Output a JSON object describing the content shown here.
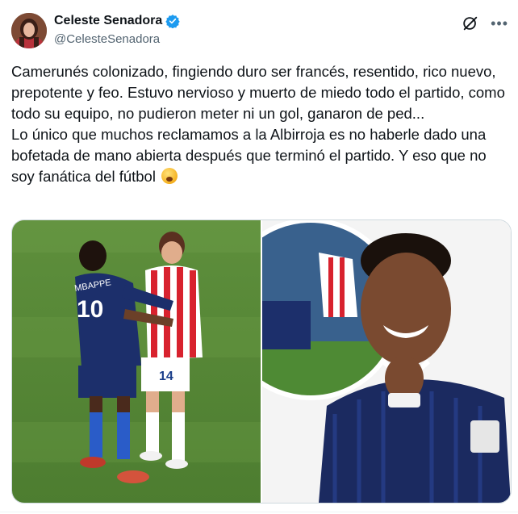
{
  "author": {
    "display_name": "Celeste Senadora",
    "handle": "@CelesteSenadora",
    "verified_badge": "verified-badge-icon",
    "avatar": "avatar"
  },
  "tweet": {
    "text_1": "Camerunés colonizado, fingiendo duro ser francés, resentido, rico nuevo, prepotente y feo. Estuvo nervioso y muerto de miedo todo el partido, como todo su equipo, no pudieron meter ni un gol, ganaron de ped...",
    "text_2": "Lo único que muchos reclamamos a la Albirroja es no haberle dado una bofetada de mano abierta después que terminó el partido. Y eso que no soy fanática del fútbol"
  },
  "media": {
    "image_left": "photo-players-confrontation",
    "image_right": "photo-player-smiling-collage",
    "left_jersey_back": "10",
    "left_jersey_name": "MBAPPE",
    "right_jersey_number": "14"
  },
  "colors": {
    "accent": "#1d9bf0",
    "text": "#0f1419",
    "secondary": "#536471",
    "border": "#cfd9de"
  }
}
